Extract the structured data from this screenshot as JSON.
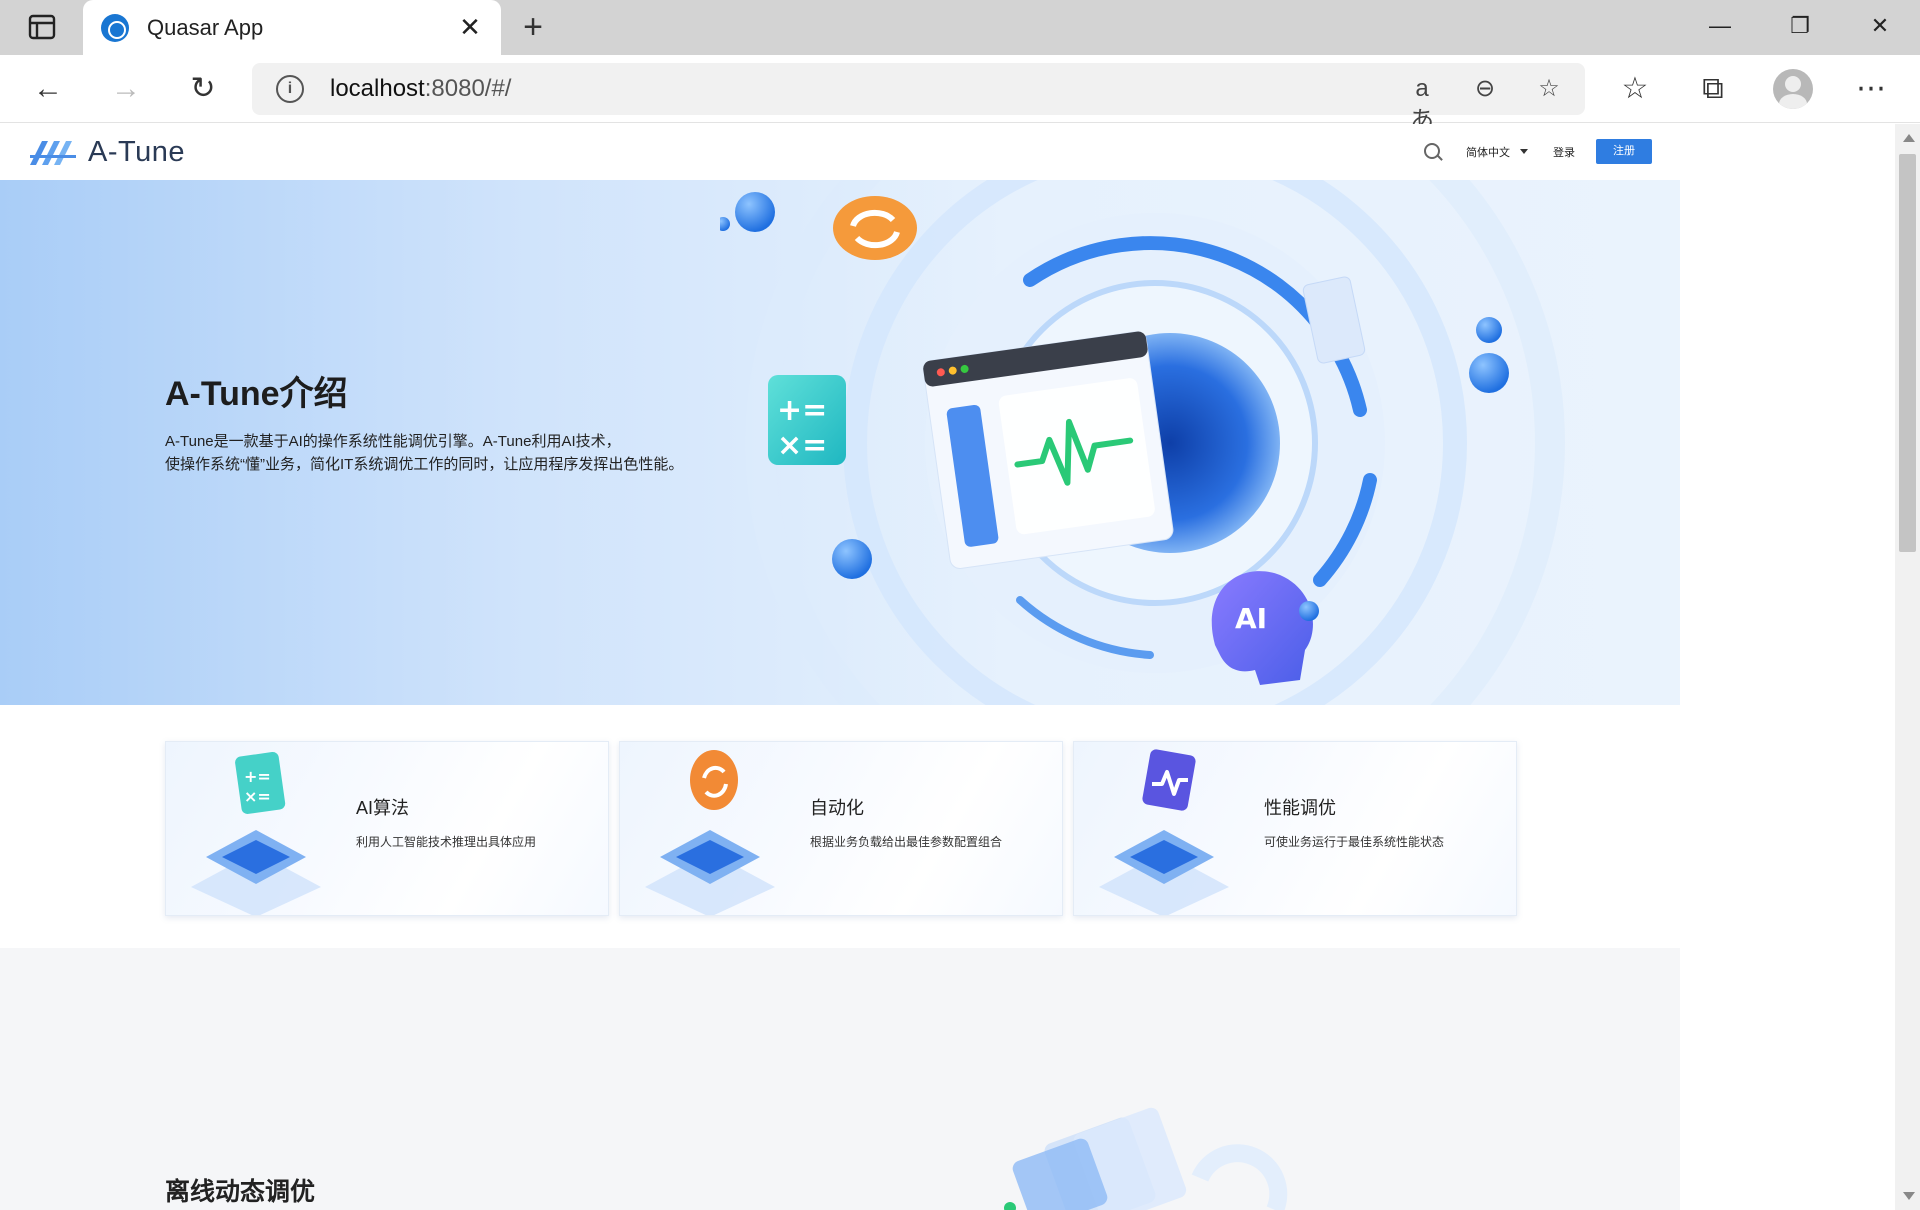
{
  "browser": {
    "tab_title": "Quasar App",
    "url_host": "localhost",
    "url_rest": ":8080/#/"
  },
  "site": {
    "logo_text": "A-Tune",
    "language": "简体中文",
    "login": "登录",
    "register": "注册"
  },
  "hero": {
    "title": "A-Tune介绍",
    "desc_line1": "A-Tune是一款基于AI的操作系统性能调优引擎。A-Tune利用AI技术，",
    "desc_line2": "使操作系统“懂”业务，简化IT系统调优工作的同时，让应用程序发挥出色性能。",
    "art_ai_label": "AI"
  },
  "features": [
    {
      "title": "AI算法",
      "desc": "利用人工智能技术推理出具体应用",
      "icon": "calculator-icon"
    },
    {
      "title": "自动化",
      "desc": "根据业务负载给出最佳参数配置组合",
      "icon": "refresh-icon"
    },
    {
      "title": "性能调优",
      "desc": "可使业务运行于最佳系统性能状态",
      "icon": "pulse-icon"
    }
  ],
  "section2": {
    "title": "离线动态调优"
  },
  "colors": {
    "accent": "#2f7de1",
    "hero_bg": "#cfe3fb"
  }
}
